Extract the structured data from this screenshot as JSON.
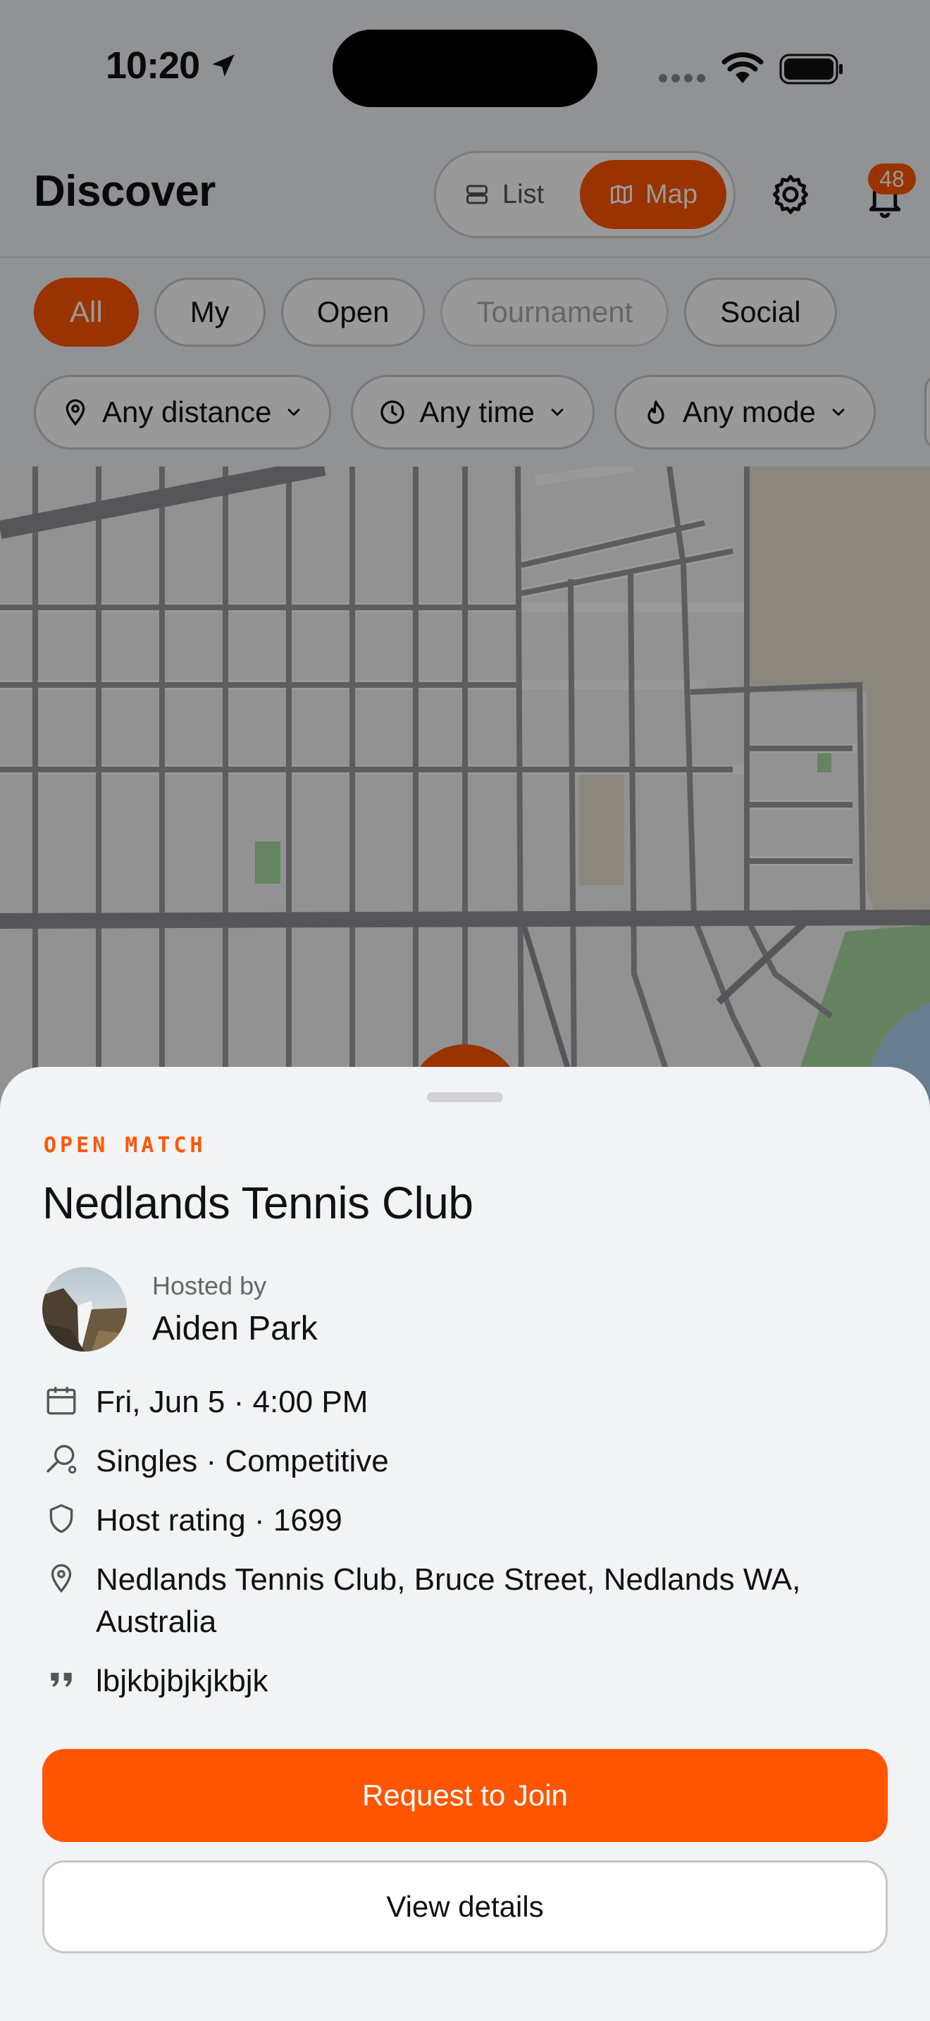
{
  "status_bar": {
    "time": "10:20"
  },
  "header": {
    "title": "Discover",
    "toggle": {
      "list_label": "List",
      "map_label": "Map",
      "selected": "Map"
    },
    "notification_count": "48"
  },
  "chips": [
    {
      "label": "All",
      "state": "active"
    },
    {
      "label": "My",
      "state": "default"
    },
    {
      "label": "Open",
      "state": "default"
    },
    {
      "label": "Tournament",
      "state": "disabled"
    },
    {
      "label": "Social",
      "state": "default"
    }
  ],
  "filters": {
    "distance": "Any distance",
    "time": "Any time",
    "mode": "Any mode"
  },
  "sheet": {
    "eyebrow": "OPEN MATCH",
    "title": "Nedlands Tennis Club",
    "hosted_by_label": "Hosted by",
    "host_name": "Aiden Park",
    "datetime": "Fri, Jun 5 · 4:00 PM",
    "format": "Singles · Competitive",
    "rating": "Host rating · 1699",
    "address": "Nedlands Tennis Club, Bruce Street, Nedlands WA, Australia",
    "note": "lbjkbjbjkjkbjk",
    "primary_button": "Request to Join",
    "secondary_button": "View details"
  },
  "colors": {
    "accent": "#ff5500",
    "background": "#f2f3f5",
    "text": "#111111",
    "muted": "#666666"
  }
}
